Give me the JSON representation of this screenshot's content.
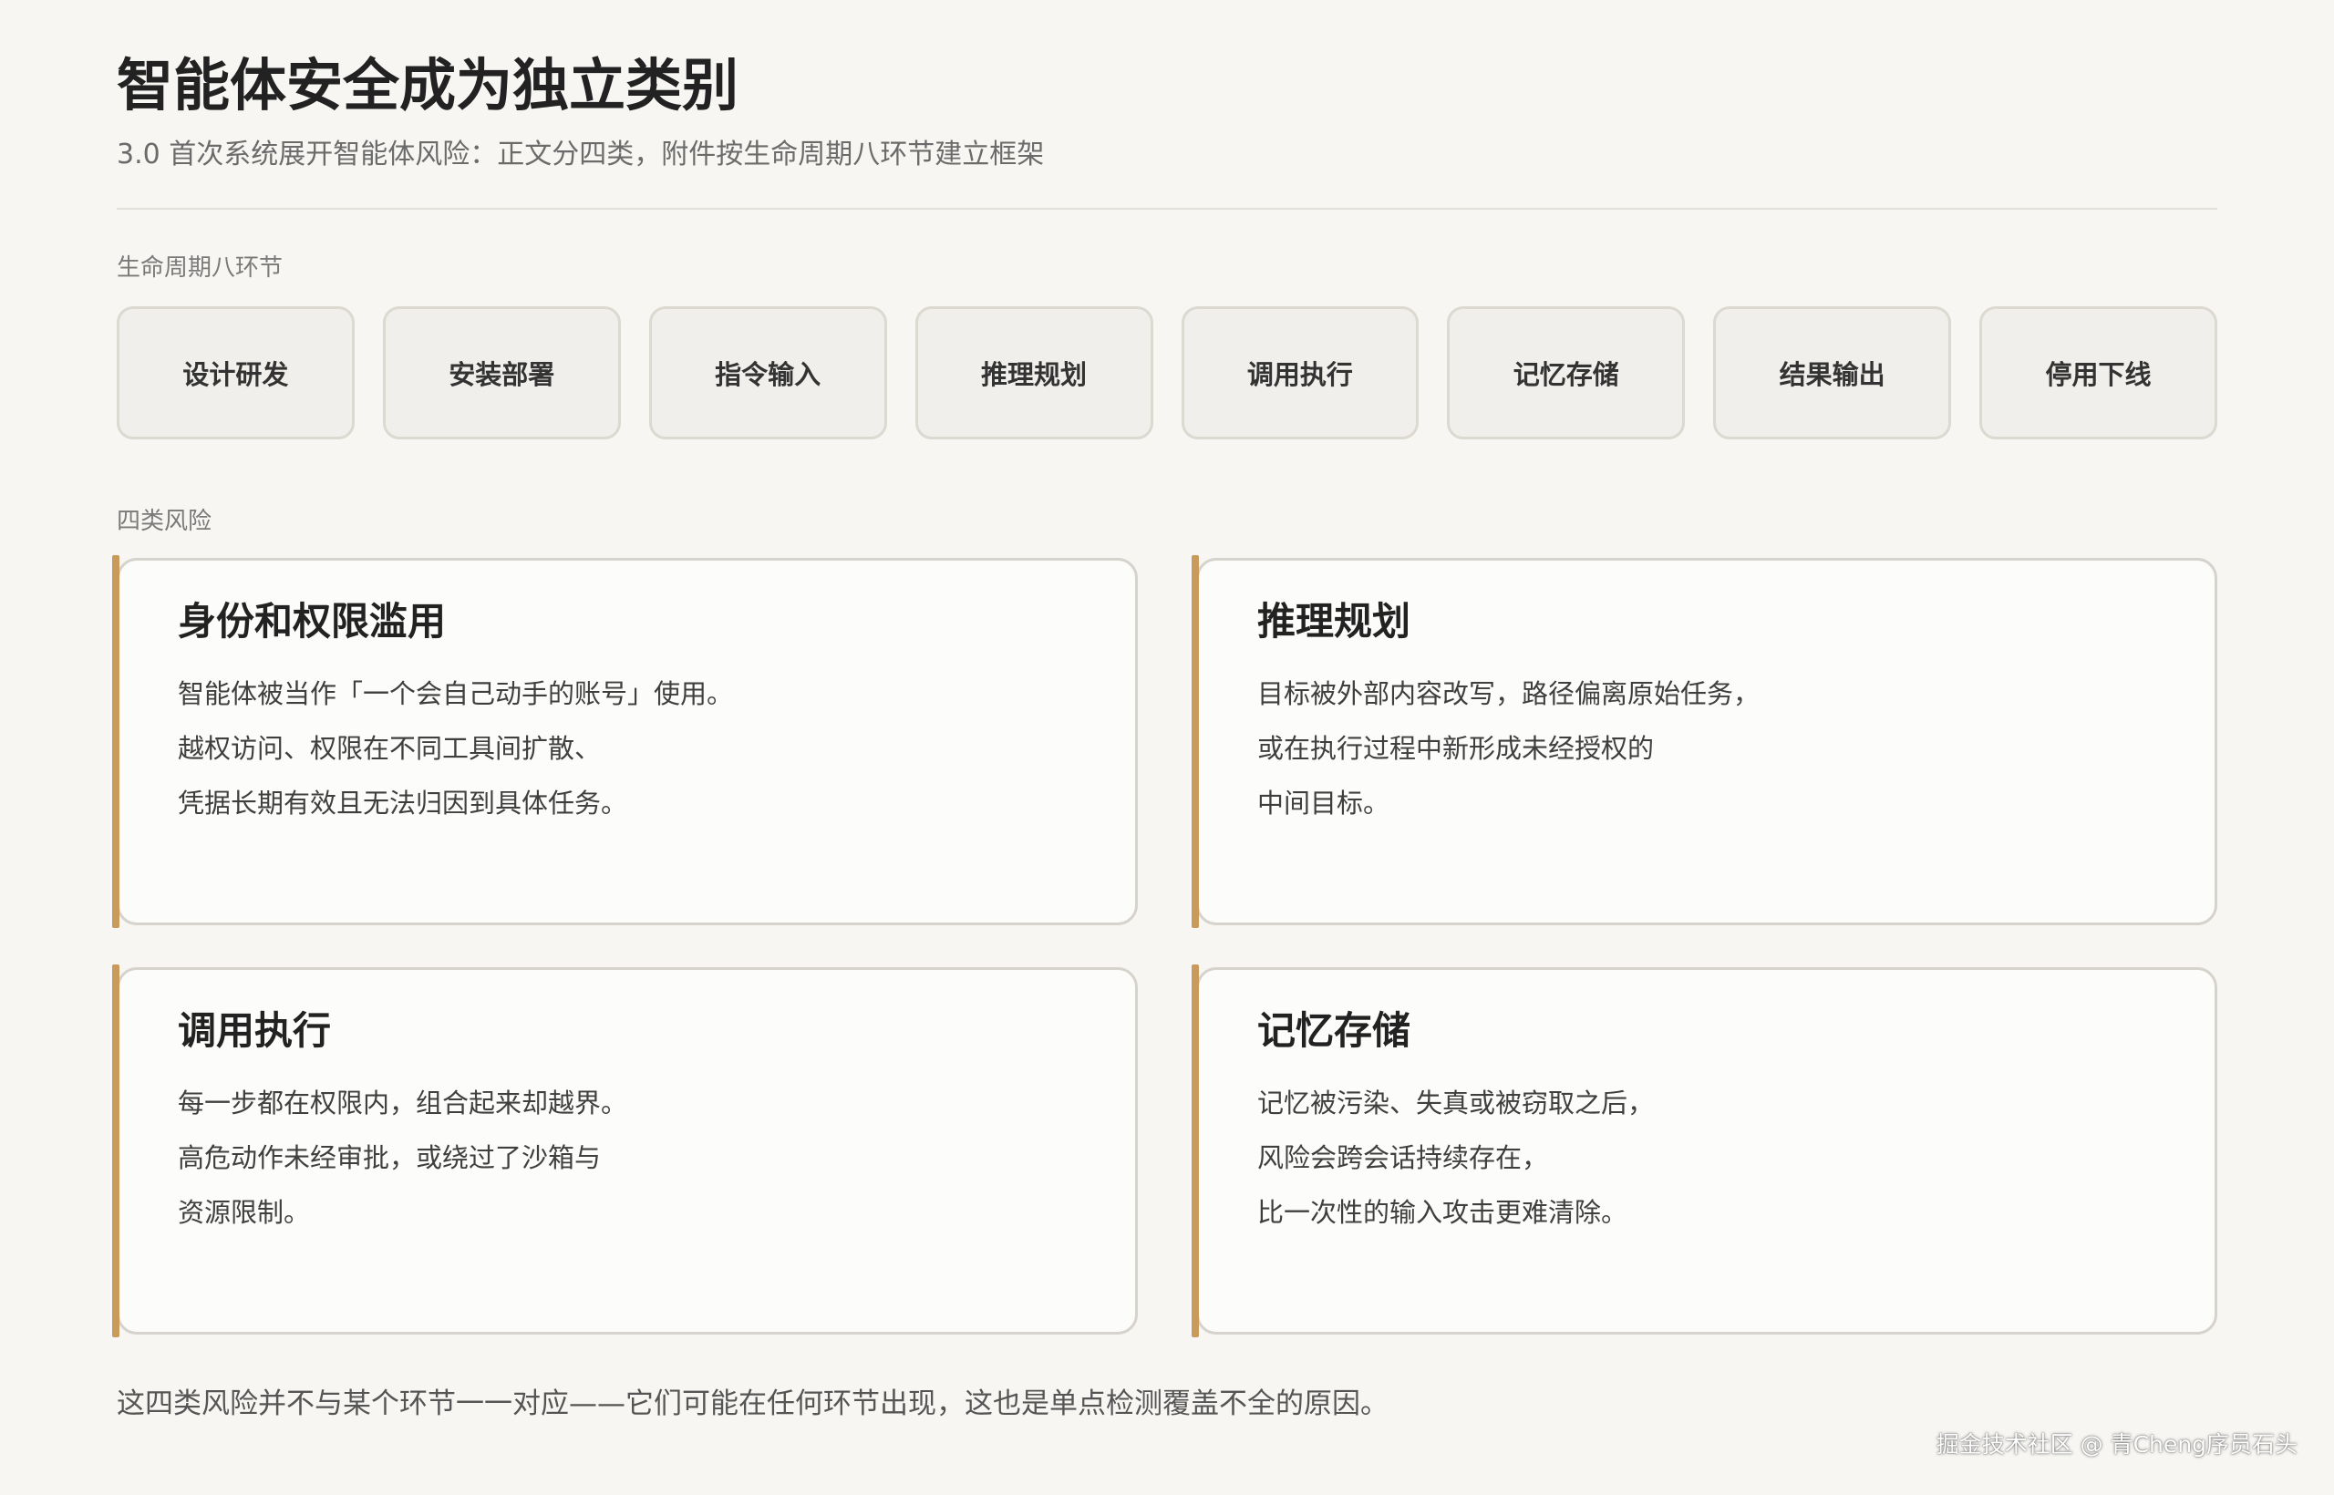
{
  "header": {
    "title": "智能体安全成为独立类别",
    "subtitle": "3.0 首次系统展开智能体风险：正文分四类，附件按生命周期八环节建立框架"
  },
  "lifecycle": {
    "label": "生命周期八环节",
    "stages": [
      "设计研发",
      "安装部署",
      "指令输入",
      "推理规划",
      "调用执行",
      "记忆存储",
      "结果输出",
      "停用下线"
    ]
  },
  "risks": {
    "label": "四类风险",
    "cards": [
      {
        "title": "身份和权限滥用",
        "lines": [
          "智能体被当作「一个会自己动手的账号」使用。",
          "越权访问、权限在不同工具间扩散、",
          "凭据长期有效且无法归因到具体任务。"
        ]
      },
      {
        "title": "推理规划",
        "lines": [
          "目标被外部内容改写，路径偏离原始任务，",
          "或在执行过程中新形成未经授权的",
          "中间目标。"
        ]
      },
      {
        "title": "调用执行",
        "lines": [
          "每一步都在权限内，组合起来却越界。",
          "高危动作未经审批，或绕过了沙箱与",
          "资源限制。"
        ]
      },
      {
        "title": "记忆存储",
        "lines": [
          "记忆被污染、失真或被窃取之后，",
          "风险会跨会话持续存在，",
          "比一次性的输入攻击更难清除。"
        ]
      }
    ]
  },
  "footer": {
    "note": "这四类风险并不与某个环节一一对应——它们可能在任何环节出现，这也是单点检测覆盖不全的原因。",
    "watermark": "掘金技术社区 @ 青Cheng序员石头"
  },
  "colors": {
    "accent": "#c99a5b",
    "background": "#f7f6f3",
    "card_border": "#d6d3cc"
  }
}
